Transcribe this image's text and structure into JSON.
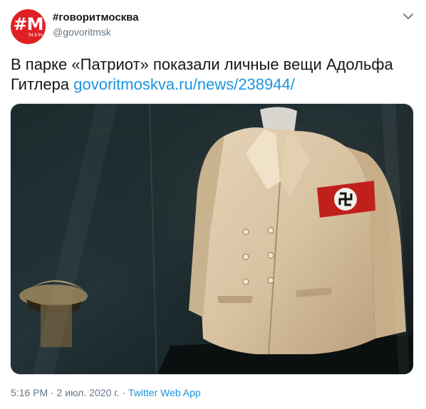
{
  "account": {
    "display_name": "#говоритмосква",
    "handle": "@govoritmsk",
    "avatar_mark": "#M",
    "avatar_freq": "94.8 fm"
  },
  "tweet": {
    "text": "В парке «Патриот» показали личные вещи Адольфа Гитлера",
    "link": "govoritmoskva.ru/news/238944/"
  },
  "meta": {
    "time": "5:16 PM",
    "separator": "·",
    "date": "2 июл. 2020 г.",
    "source": "Twitter Web App"
  },
  "colors": {
    "brand_red": "#e01f26",
    "link_blue": "#1b95e0",
    "meta_gray": "#657786"
  },
  "icons": {
    "menu": "chevron-down-icon"
  }
}
